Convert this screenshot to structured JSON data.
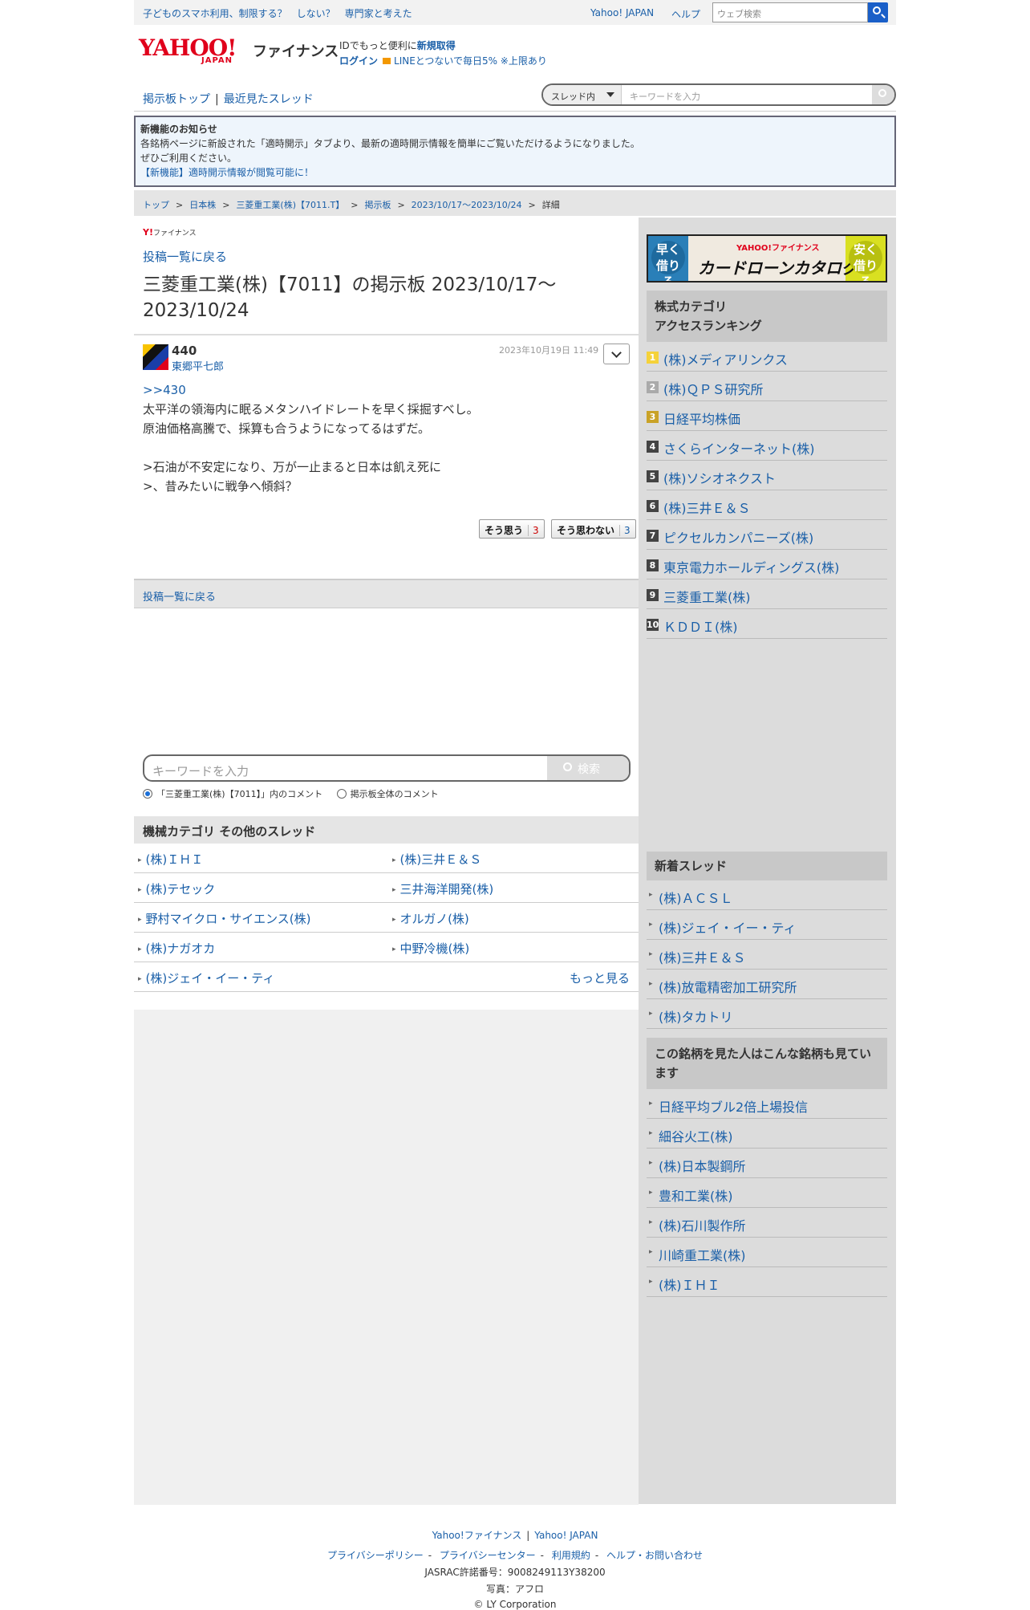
{
  "topbar": {
    "promo": "子どものスマホ利用、制限する？　しない？　専門家と考えた",
    "yahoo_japan": "Yahoo! JAPAN",
    "help": "ヘルプ",
    "web_search_placeholder": "ウェブ検索"
  },
  "header": {
    "logo": "YAHOO!",
    "logo_sub": "JAPAN",
    "finance": "ファイナンス",
    "id_text": "IDでもっと便利に",
    "signup": "新規取得",
    "login": "ログイン",
    "line_promo": "LINEとつないで毎日5% ※上限あり"
  },
  "nav": {
    "board_top": "掲示板トップ",
    "recent": "最近見たスレッド",
    "scope": "スレッド内",
    "keyword_placeholder": "キーワードを入力"
  },
  "notice": {
    "title": "新機能のお知らせ",
    "line1": "各銘柄ページに新設された「適時開示」タブより、最新の適時開示情報を簡単にご覧いただけるようになりました。",
    "line2": "ぜひご利用ください。",
    "link": "【新機能】適時開示情報が閲覧可能に！"
  },
  "breadcrumb": [
    "トップ",
    "日本株",
    "三菱重工業(株)【7011.T】",
    "掲示板",
    "2023/10/17〜2023/10/24",
    "詳細"
  ],
  "main": {
    "small_logo_y": "Y!",
    "small_logo_text": "ファイナンス",
    "back_link": "投稿一覧に戻る",
    "title": "三菱重工業(株)【7011】の掲示板 2023/10/17〜2023/10/24",
    "post": {
      "number": "440",
      "user": "東郷平七郎",
      "date": "2023年10月19日 11:49",
      "reply": ">>430",
      "body": "太平洋の領海内に眠るメタンハイドレートを早く採掘すべし。\n原油価格高騰で、採算も合うようになってるはずだ。\n\n>石油が不安定になり、万が一止まると日本は飢え死に\n>、昔みたいに戦争へ傾斜？",
      "agree_label": "そう思う",
      "agree_count": "3",
      "disagree_label": "そう思わない",
      "disagree_count": "3"
    },
    "back_link2": "投稿一覧に戻る",
    "keyword_placeholder": "キーワードを入力",
    "search_btn": "検索",
    "radio_thread": "「三菱重工業(株)【7011】」内のコメント",
    "radio_all": "掲示板全体のコメント",
    "category_header": "機械カテゴリ  その他のスレッド",
    "category_rows": [
      [
        "(株)ＩＨＩ",
        "(株)三井Ｅ＆Ｓ"
      ],
      [
        "(株)テセック",
        "三井海洋開発(株)"
      ],
      [
        "野村マイクロ・サイエンス(株)",
        "オルガノ(株)"
      ],
      [
        "(株)ナガオカ",
        "中野冷機(株)"
      ],
      [
        "(株)ジェイ・イー・ティ",
        ""
      ]
    ],
    "more": "もっと見る"
  },
  "side": {
    "banner_left": "早く借りる",
    "banner_main": "カードローンカタログ",
    "banner_right": "安く借りる",
    "banner_logo": "YAHOO!ファイナンス",
    "ranking_title": "株式カテゴリ\nアクセスランキング",
    "ranking": [
      "(株)メディアリンクス",
      "(株)ＱＰＳ研究所",
      "日経平均株価",
      "さくらインターネット(株)",
      "(株)ソシオネクスト",
      "(株)三井Ｅ＆Ｓ",
      "ピクセルカンパニーズ(株)",
      "東京電力ホールディングス(株)",
      "三菱重工業(株)",
      "ＫＤＤＩ(株)"
    ],
    "rank_colors": [
      "#f5d23a",
      "#aaaaaa",
      "#c9a227",
      "#444444",
      "#444444",
      "#444444",
      "#444444",
      "#444444",
      "#444444",
      "#444444"
    ],
    "new_title": "新着スレッド",
    "new_threads": [
      "(株)ＡＣＳＬ",
      "(株)ジェイ・イー・ティ",
      "(株)三井Ｅ＆Ｓ",
      "(株)放電精密加工研究所",
      "(株)タカトリ"
    ],
    "also_title": "この銘柄を見た人はこんな銘柄も見ています",
    "also": [
      "日経平均ブル2倍上場投信",
      "細谷火工(株)",
      "(株)日本製鋼所",
      "豊和工業(株)",
      "(株)石川製作所",
      "川崎重工業(株)",
      "(株)ＩＨＩ"
    ]
  },
  "footer": {
    "yf": "Yahoo!ファイナンス",
    "yj": "Yahoo! JAPAN",
    "links": [
      "プライバシーポリシー",
      "プライバシーセンター",
      "利用規約",
      "ヘルプ・お問い合わせ"
    ],
    "jasrac": "JASRAC許諾番号：9008249113Y38200",
    "photo": "写真：アフロ",
    "copyright": "© LY Corporation"
  }
}
